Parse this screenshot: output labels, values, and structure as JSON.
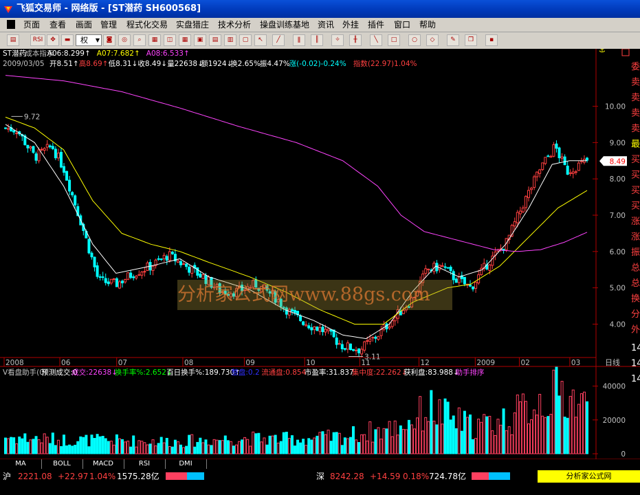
{
  "window": {
    "title": "飞狐交易师 - 网络版 - [ST潜药 SH600568]"
  },
  "menu": [
    "页面",
    "查看",
    "画面",
    "管理",
    "程式化交易",
    "实盘猎庄",
    "技术分析",
    "操盘训练基地",
    "资讯",
    "外挂",
    "插件",
    "窗口",
    "帮助"
  ],
  "toolbar": {
    "quan_label": "权",
    "rsi_label": "RSI"
  },
  "info": {
    "line1": [
      {
        "text": "ST潜药",
        "color": "#ffffff"
      },
      {
        "text": "成本指示",
        "color": "#c0c0c0"
      },
      {
        "text": "A06:8.299↑",
        "color": "#ffffff"
      },
      {
        "text": "A07:7.682↑",
        "color": "#ffff00"
      },
      {
        "text": "A08:6.533↑",
        "color": "#ff44ff"
      }
    ],
    "line2": [
      {
        "text": "2009/03/05",
        "color": "#c0c0c0"
      },
      {
        "text": "开8.51↑",
        "color": "#ffffff"
      },
      {
        "text": "高8.69↑",
        "color": "#ff4040"
      },
      {
        "text": "低8.31↓",
        "color": "#ffffff"
      },
      {
        "text": "收8.49↓",
        "color": "#ffffff"
      },
      {
        "text": "量22638↓",
        "color": "#ffffff"
      },
      {
        "text": "额1924↓",
        "color": "#ffffff"
      },
      {
        "text": "换2.65%",
        "color": "#ffffff"
      },
      {
        "text": "振4.47%",
        "color": "#ffffff"
      },
      {
        "text": "涨(-0.02)-0.24%",
        "color": "#00ffff"
      },
      {
        "text": "指数(22.97)1.04%",
        "color": "#ff4040"
      }
    ]
  },
  "volume_header": [
    {
      "text": "V看盘助手(0)",
      "color": "#c0c0c0"
    },
    {
      "text": "预测成交:0",
      "color": "#ffffff"
    },
    {
      "text": "成交:22638↓",
      "color": "#ff44ff"
    },
    {
      "text": "换手率%:2.652↓",
      "color": "#00ff00"
    },
    {
      "text": "百日换手%:189.730↑",
      "color": "#ffffff"
    },
    {
      "text": "整盘:0.2",
      "color": "#3030ff"
    },
    {
      "text": "流通盘:0.854",
      "color": "#ff4040"
    },
    {
      "text": "市盈率:31.837",
      "color": "#ffffff"
    },
    {
      "text": "集中度:22.262↓",
      "color": "#ff4040"
    },
    {
      "text": "获利盘:83.988↓",
      "color": "#ffffff"
    },
    {
      "text": "助手排序",
      "color": "#ff44ff"
    }
  ],
  "right_panel_labels": [
    "委",
    "卖",
    "卖",
    "卖",
    "卖",
    "最",
    "买",
    "买",
    "买",
    "买",
    "涨",
    "涨",
    "振",
    "总",
    "总",
    "换",
    "分",
    "外",
    "14",
    "14",
    "14"
  ],
  "right_panel_label_colors": [
    "#ff4040",
    "#ff4040",
    "#ff4040",
    "#ff4040",
    "#ff4040",
    "#ffff00",
    "#ff4040",
    "#ff4040",
    "#ff4040",
    "#ff4040",
    "#ff4040",
    "#ff4040",
    "#ff4040",
    "#ff4040",
    "#ff4040",
    "#ff4040",
    "#ff4040",
    "#ff4040",
    "#ffffff",
    "#ffffff",
    "#ffffff"
  ],
  "tabs": [
    "MA",
    "BOLL",
    "MACD",
    "RSI",
    "DMI"
  ],
  "status": {
    "sh_label": "沪",
    "sh_index": "2221.08",
    "sh_change": "+22.97",
    "sh_pct": "1.04%",
    "sh_amount": "1575.28亿",
    "sz_label": "深",
    "sz_index": "8242.28",
    "sz_change": "+14.59",
    "sz_pct": "0.18%",
    "sz_amount": "724.78亿",
    "brand": "分析家公式网www.88gs.com"
  },
  "watermark": "分析家公式网www.88gs.com",
  "chart_data": [
    {
      "type": "candlestick",
      "title": "ST潜药 成本指示",
      "ylim": [
        3.1,
        10.9
      ],
      "y_ticks": [
        4.0,
        5.0,
        6.0,
        7.0,
        8.0,
        9.0,
        10.0
      ],
      "y_tick_labels": [
        "4.00",
        "5.00",
        "6.00",
        "7.00",
        "8.00",
        "9.00",
        "10.00"
      ],
      "x_labels": [
        "2008",
        "06",
        "07",
        "08",
        "09",
        "10",
        "11",
        "12",
        "2009",
        "02",
        "03"
      ],
      "x_label_fractions": [
        0.0,
        0.096,
        0.194,
        0.308,
        0.414,
        0.518,
        0.613,
        0.715,
        0.812,
        0.888,
        0.975
      ],
      "periodicity_label": "日线",
      "annotations": [
        {
          "text": "9.72",
          "anchor": "high"
        },
        {
          "text": "3.11",
          "anchor": "low"
        }
      ],
      "current_price_label": "8.49",
      "anchors": [
        {
          "t": 0.0,
          "p": 9.4
        },
        {
          "t": 0.02,
          "p": 9.35
        },
        {
          "t": 0.05,
          "p": 8.6
        },
        {
          "t": 0.08,
          "p": 8.9
        },
        {
          "t": 0.1,
          "p": 8.3
        },
        {
          "t": 0.13,
          "p": 6.8
        },
        {
          "t": 0.16,
          "p": 5.2
        },
        {
          "t": 0.19,
          "p": 5.1
        },
        {
          "t": 0.22,
          "p": 5.4
        },
        {
          "t": 0.25,
          "p": 5.6
        },
        {
          "t": 0.28,
          "p": 5.9
        },
        {
          "t": 0.31,
          "p": 5.6
        },
        {
          "t": 0.34,
          "p": 5.3
        },
        {
          "t": 0.37,
          "p": 4.9
        },
        {
          "t": 0.4,
          "p": 4.9
        },
        {
          "t": 0.43,
          "p": 5.1
        },
        {
          "t": 0.46,
          "p": 4.8
        },
        {
          "t": 0.49,
          "p": 4.3
        },
        {
          "t": 0.52,
          "p": 4.0
        },
        {
          "t": 0.55,
          "p": 3.8
        },
        {
          "t": 0.58,
          "p": 3.4
        },
        {
          "t": 0.61,
          "p": 3.3
        },
        {
          "t": 0.64,
          "p": 3.7
        },
        {
          "t": 0.67,
          "p": 4.2
        },
        {
          "t": 0.7,
          "p": 4.7
        },
        {
          "t": 0.725,
          "p": 5.5
        },
        {
          "t": 0.75,
          "p": 5.6
        },
        {
          "t": 0.77,
          "p": 5.3
        },
        {
          "t": 0.8,
          "p": 5.0
        },
        {
          "t": 0.83,
          "p": 5.7
        },
        {
          "t": 0.86,
          "p": 6.2
        },
        {
          "t": 0.89,
          "p": 7.3
        },
        {
          "t": 0.92,
          "p": 8.3
        },
        {
          "t": 0.945,
          "p": 8.9
        },
        {
          "t": 0.965,
          "p": 8.2
        },
        {
          "t": 1.0,
          "p": 8.5
        }
      ],
      "ma_lines": [
        {
          "name": "A06",
          "value": 8.299,
          "color": "#ffffff",
          "points": [
            {
              "t": 0.0,
              "p": 9.5
            },
            {
              "t": 0.05,
              "p": 9.0
            },
            {
              "t": 0.1,
              "p": 7.8
            },
            {
              "t": 0.15,
              "p": 6.2
            },
            {
              "t": 0.19,
              "p": 5.4
            },
            {
              "t": 0.25,
              "p": 5.6
            },
            {
              "t": 0.3,
              "p": 5.8
            },
            {
              "t": 0.35,
              "p": 5.3
            },
            {
              "t": 0.42,
              "p": 4.95
            },
            {
              "t": 0.48,
              "p": 4.4
            },
            {
              "t": 0.53,
              "p": 4.1
            },
            {
              "t": 0.58,
              "p": 3.7
            },
            {
              "t": 0.62,
              "p": 3.6
            },
            {
              "t": 0.66,
              "p": 4.0
            },
            {
              "t": 0.7,
              "p": 4.9
            },
            {
              "t": 0.74,
              "p": 5.6
            },
            {
              "t": 0.78,
              "p": 5.3
            },
            {
              "t": 0.82,
              "p": 5.5
            },
            {
              "t": 0.86,
              "p": 6.2
            },
            {
              "t": 0.9,
              "p": 7.2
            },
            {
              "t": 0.94,
              "p": 8.4
            },
            {
              "t": 0.97,
              "p": 8.5
            },
            {
              "t": 1.0,
              "p": 8.5
            }
          ]
        },
        {
          "name": "A07",
          "value": 7.682,
          "color": "#ffff00",
          "points": [
            {
              "t": 0.0,
              "p": 9.7
            },
            {
              "t": 0.05,
              "p": 9.4
            },
            {
              "t": 0.1,
              "p": 8.8
            },
            {
              "t": 0.15,
              "p": 7.4
            },
            {
              "t": 0.2,
              "p": 6.5
            },
            {
              "t": 0.25,
              "p": 6.2
            },
            {
              "t": 0.3,
              "p": 6.0
            },
            {
              "t": 0.35,
              "p": 5.7
            },
            {
              "t": 0.42,
              "p": 5.3
            },
            {
              "t": 0.48,
              "p": 4.9
            },
            {
              "t": 0.54,
              "p": 4.4
            },
            {
              "t": 0.6,
              "p": 4.0
            },
            {
              "t": 0.65,
              "p": 4.0
            },
            {
              "t": 0.7,
              "p": 4.6
            },
            {
              "t": 0.76,
              "p": 5.0
            },
            {
              "t": 0.8,
              "p": 5.1
            },
            {
              "t": 0.85,
              "p": 5.6
            },
            {
              "t": 0.9,
              "p": 6.4
            },
            {
              "t": 0.95,
              "p": 7.2
            },
            {
              "t": 1.0,
              "p": 7.68
            }
          ]
        },
        {
          "name": "A08",
          "value": 6.533,
          "color": "#ff44ff",
          "points": [
            {
              "t": 0.0,
              "p": 10.85
            },
            {
              "t": 0.1,
              "p": 10.7
            },
            {
              "t": 0.2,
              "p": 10.4
            },
            {
              "t": 0.3,
              "p": 9.95
            },
            {
              "t": 0.4,
              "p": 9.45
            },
            {
              "t": 0.5,
              "p": 9.0
            },
            {
              "t": 0.58,
              "p": 8.5
            },
            {
              "t": 0.64,
              "p": 7.8
            },
            {
              "t": 0.68,
              "p": 7.0
            },
            {
              "t": 0.72,
              "p": 6.55
            },
            {
              "t": 0.78,
              "p": 6.3
            },
            {
              "t": 0.84,
              "p": 6.05
            },
            {
              "t": 0.88,
              "p": 6.0
            },
            {
              "t": 0.92,
              "p": 6.05
            },
            {
              "t": 0.96,
              "p": 6.25
            },
            {
              "t": 1.0,
              "p": 6.53
            }
          ]
        }
      ]
    },
    {
      "type": "bar",
      "title": "V看盘助手(0)",
      "ylim": [
        0,
        50000
      ],
      "y_ticks": [
        0,
        20000,
        40000
      ],
      "y_tick_labels": [
        "0",
        "20000",
        "40000"
      ],
      "last_value": 22638,
      "volume_profile": [
        {
          "t": 0.0,
          "v": 11000
        },
        {
          "t": 0.1,
          "v": 9000
        },
        {
          "t": 0.2,
          "v": 8500
        },
        {
          "t": 0.3,
          "v": 8000
        },
        {
          "t": 0.4,
          "v": 10000
        },
        {
          "t": 0.5,
          "v": 9500
        },
        {
          "t": 0.58,
          "v": 11000
        },
        {
          "t": 0.62,
          "v": 14000
        },
        {
          "t": 0.66,
          "v": 16000
        },
        {
          "t": 0.7,
          "v": 22000
        },
        {
          "t": 0.73,
          "v": 30000
        },
        {
          "t": 0.76,
          "v": 24000
        },
        {
          "t": 0.8,
          "v": 18000
        },
        {
          "t": 0.84,
          "v": 20000
        },
        {
          "t": 0.88,
          "v": 26000
        },
        {
          "t": 0.92,
          "v": 36000
        },
        {
          "t": 0.96,
          "v": 40000
        },
        {
          "t": 1.0,
          "v": 30000
        }
      ]
    }
  ]
}
